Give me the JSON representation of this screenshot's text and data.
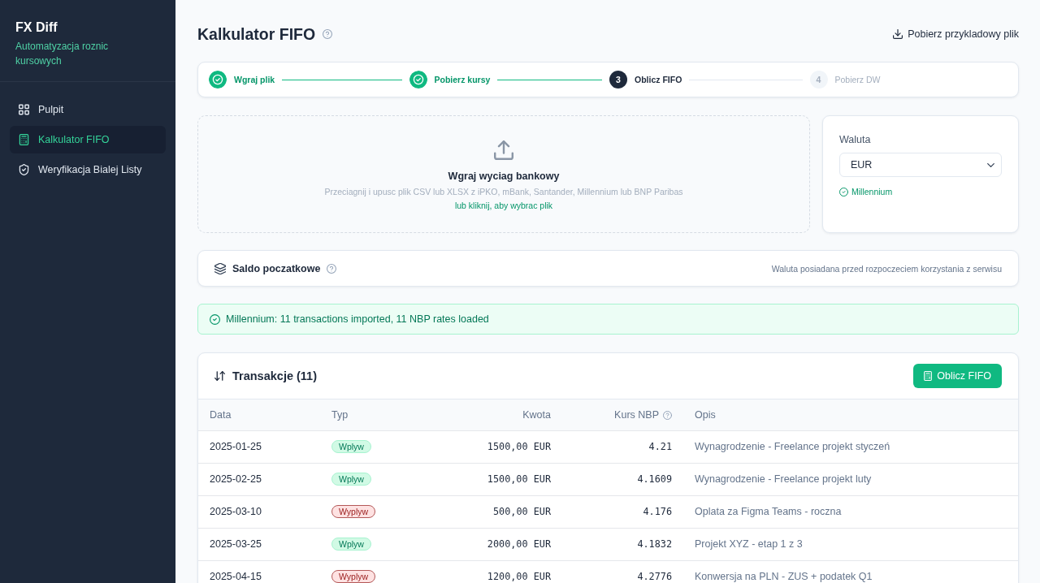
{
  "sidebar": {
    "app_name": "FX Diff",
    "tagline": "Automatyzacja roznic kursowych",
    "items": [
      {
        "label": "Pulpit",
        "selected": false
      },
      {
        "label": "Kalkulator FIFO",
        "selected": true
      },
      {
        "label": "Weryfikacja Bialej Listy",
        "selected": false
      }
    ]
  },
  "header": {
    "title": "Kalkulator FIFO",
    "download_link": "Pobierz przykladowy plik"
  },
  "stepper": {
    "steps": [
      {
        "label": "Wgraj plik",
        "completed": true,
        "selected": false
      },
      {
        "label": "Pobierz kursy",
        "completed": true,
        "selected": false
      },
      {
        "number": "3",
        "label": "Oblicz FIFO",
        "completed": false,
        "selected": true
      },
      {
        "number": "4",
        "label": "Pobierz DW",
        "completed": false,
        "selected": false
      }
    ]
  },
  "upload": {
    "title": "Wgraj wyciag bankowy",
    "description": "Przeciagnij i upusc plik CSV lub XLSX z iPKO, mBank, Santander, Millennium lub BNP Paribas",
    "link": "lub kliknij, aby wybrac plik"
  },
  "currency": {
    "label": "Waluta",
    "value": "EUR",
    "detected_bank": "Millennium"
  },
  "opening_balance": {
    "title": "Saldo poczatkowe",
    "note": "Waluta posiadana przed rozpoczeciem korzystania z serwisu"
  },
  "alert": {
    "text": "Millennium: 11 transactions imported, 11 NBP rates loaded"
  },
  "transactions": {
    "title": "Transakcje (11)",
    "button": "Oblicz FIFO",
    "columns": [
      "Data",
      "Typ",
      "Kwota",
      "Kurs NBP",
      "Opis"
    ],
    "rows": [
      {
        "date": "2025-01-25",
        "type": {
          "label": "Wplyw",
          "kind": "inflow"
        },
        "amount": "1500,00 EUR",
        "rate": "4.21",
        "description": "Wynagrodzenie - Freelance projekt styczeń"
      },
      {
        "date": "2025-02-25",
        "type": {
          "label": "Wplyw",
          "kind": "inflow"
        },
        "amount": "1500,00 EUR",
        "rate": "4.1609",
        "description": "Wynagrodzenie - Freelance projekt luty"
      },
      {
        "date": "2025-03-10",
        "type": {
          "label": "Wyplyw",
          "kind": "outflow"
        },
        "amount": "500,00 EUR",
        "rate": "4.176",
        "description": "Oplata za Figma Teams - roczna"
      },
      {
        "date": "2025-03-25",
        "type": {
          "label": "Wplyw",
          "kind": "inflow"
        },
        "amount": "2000,00 EUR",
        "rate": "4.1832",
        "description": "Projekt XYZ - etap 1 z 3"
      },
      {
        "date": "2025-04-15",
        "type": {
          "label": "Wyplyw",
          "kind": "outflow"
        },
        "amount": "1200,00 EUR",
        "rate": "4.2776",
        "description": "Konwersja na PLN - ZUS + podatek Q1"
      }
    ]
  }
}
